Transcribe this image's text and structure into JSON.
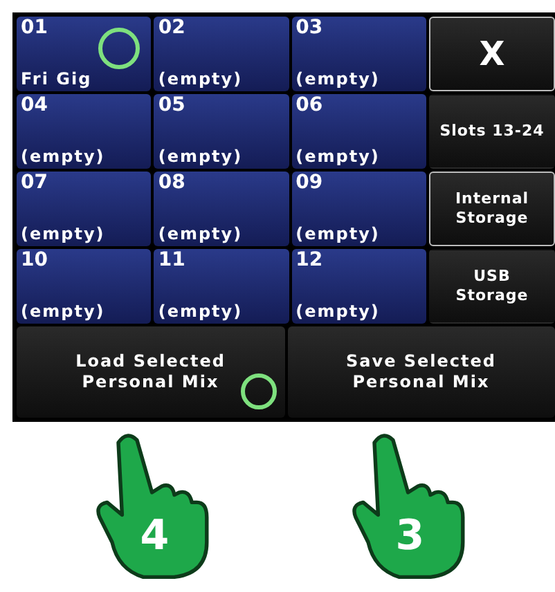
{
  "slots": [
    {
      "number": "01",
      "name": "Fri Gig"
    },
    {
      "number": "02",
      "name": "(empty)"
    },
    {
      "number": "03",
      "name": "(empty)"
    },
    {
      "number": "04",
      "name": "(empty)"
    },
    {
      "number": "05",
      "name": "(empty)"
    },
    {
      "number": "06",
      "name": "(empty)"
    },
    {
      "number": "07",
      "name": "(empty)"
    },
    {
      "number": "08",
      "name": "(empty)"
    },
    {
      "number": "09",
      "name": "(empty)"
    },
    {
      "number": "10",
      "name": "(empty)"
    },
    {
      "number": "11",
      "name": "(empty)"
    },
    {
      "number": "12",
      "name": "(empty)"
    }
  ],
  "side_buttons": [
    {
      "label": "X",
      "kind": "close",
      "outlined": true
    },
    {
      "label": "Slots 13-24",
      "kind": "text",
      "outlined": false
    },
    {
      "label": "Internal Storage",
      "kind": "text",
      "outlined": true
    },
    {
      "label": "USB Storage",
      "kind": "text",
      "outlined": false
    }
  ],
  "actions": [
    {
      "label": "Load Selected Personal Mix"
    },
    {
      "label": "Save Selected Personal Mix"
    }
  ],
  "steps": [
    {
      "number": "4"
    },
    {
      "number": "3"
    }
  ]
}
